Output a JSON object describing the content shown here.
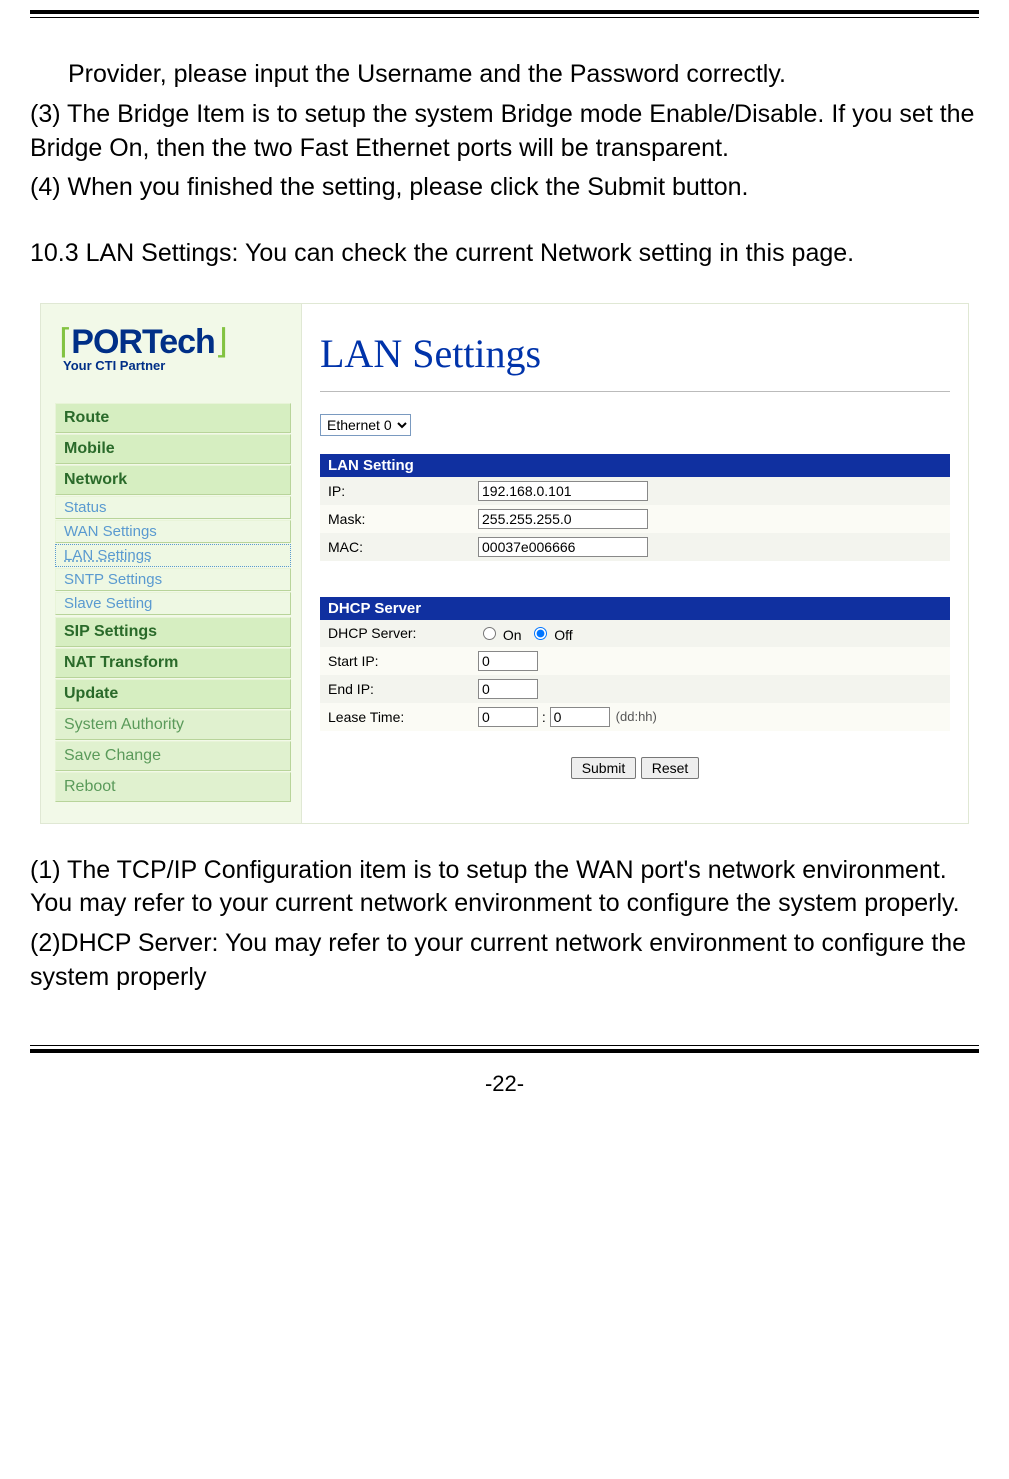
{
  "doc": {
    "para_top_line1": "Provider, please input the Username and the Password correctly.",
    "para3": "(3) The Bridge Item is to setup the system Bridge mode Enable/Disable. If you set the Bridge On, then the two Fast Ethernet ports will be transparent.",
    "para4": "(4) When you finished the setting, please click the Submit button.",
    "sec103": "10.3 LAN Settings: You can check the current Network setting in this page.",
    "bottom_para1": "(1) The TCP/IP Configuration item is to setup the WAN port's network environment. You may refer to your current network environment to configure the system properly.",
    "bottom_para2": "(2)DHCP Server: You may refer to your current network environment to configure the system properly",
    "page_number": "-22-"
  },
  "ui": {
    "logo": {
      "text": "PORTech",
      "sub": "Your CTI Partner"
    },
    "nav": {
      "route": "Route",
      "mobile": "Mobile",
      "network": "Network",
      "network_sub": {
        "status": "Status",
        "wan": "WAN Settings",
        "lan": "LAN Settings",
        "sntp": "SNTP Settings",
        "slave": "Slave Setting"
      },
      "sip": "SIP Settings",
      "nat": "NAT Transform",
      "update": "Update",
      "sysauth": "System Authority",
      "save": "Save Change",
      "reboot": "Reboot"
    },
    "title": "LAN Settings",
    "eth_selected": "Ethernet 0",
    "lan_panel": {
      "head": "LAN Setting",
      "ip_label": "IP:",
      "ip_value": "192.168.0.101",
      "mask_label": "Mask:",
      "mask_value": "255.255.255.0",
      "mac_label": "MAC:",
      "mac_value": "00037e006666"
    },
    "dhcp_panel": {
      "head": "DHCP Server",
      "dhcp_label": "DHCP Server:",
      "on": "On",
      "off": "Off",
      "start_label": "Start IP:",
      "start_value": "0",
      "end_label": "End IP:",
      "end_value": "0",
      "lease_label": "Lease Time:",
      "lease_dd": "0",
      "lease_hh": "0",
      "lease_hint": "(dd:hh)"
    },
    "buttons": {
      "submit": "Submit",
      "reset": "Reset"
    }
  }
}
